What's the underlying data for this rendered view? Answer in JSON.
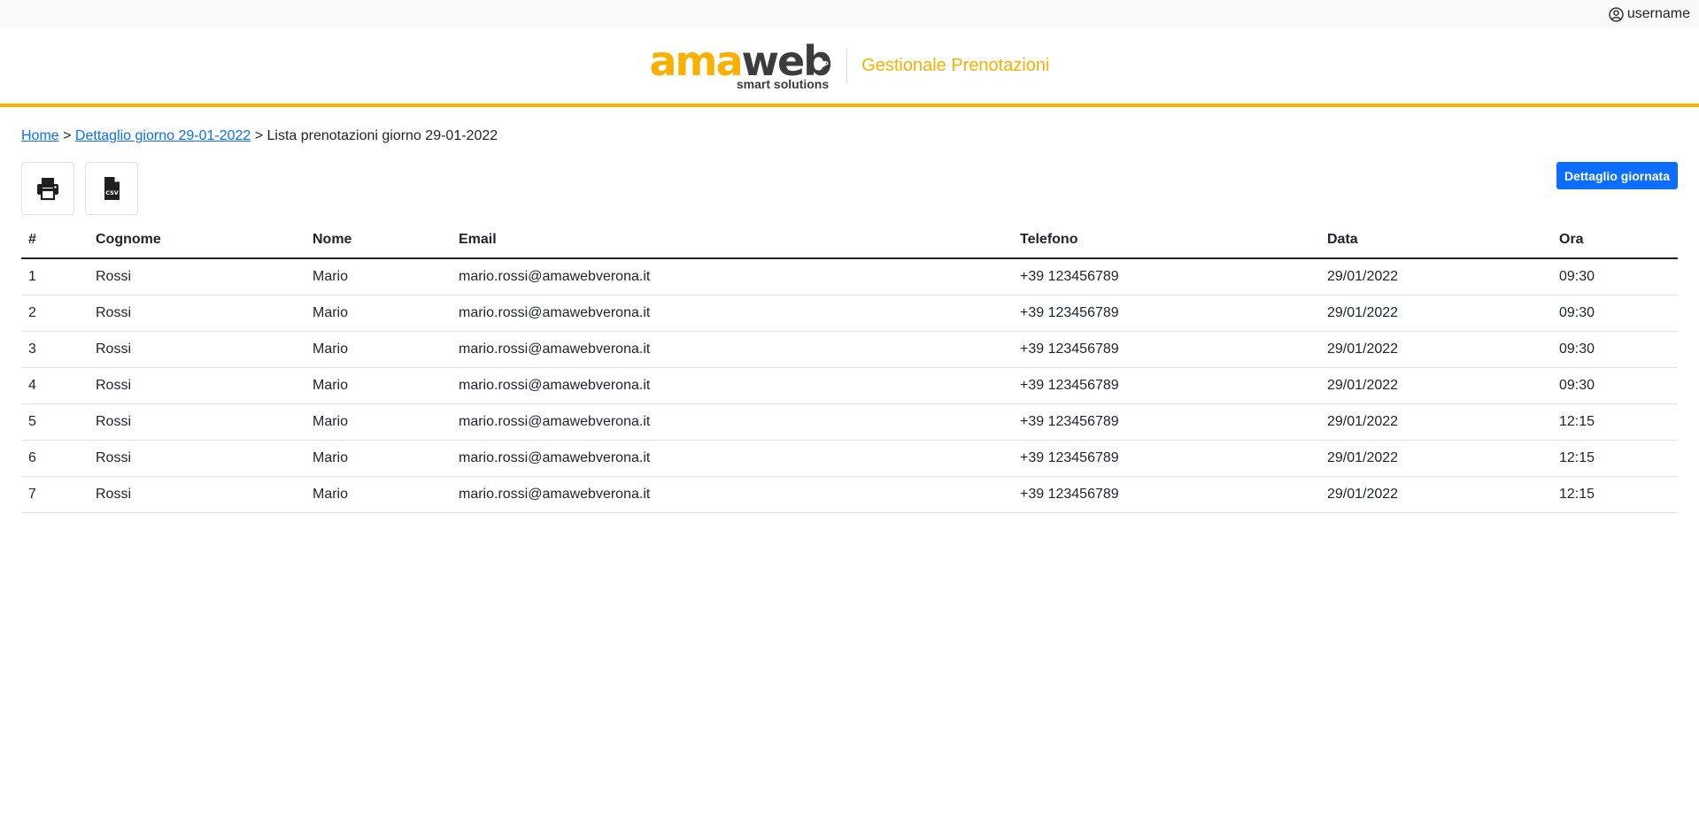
{
  "user": {
    "icon": "user-circle-icon",
    "name": "username"
  },
  "header": {
    "logo_ama": "ama",
    "logo_we": "we",
    "logo_b": "b",
    "logo_tagline": "smart solutions",
    "title": "Gestionale Prenotazioni",
    "accent_color": "#ffb000"
  },
  "breadcrumb": {
    "home": "Home",
    "sep1": " > ",
    "detail": "Dettaglio giorno 29-01-2022",
    "sep2": " > ",
    "current": "Lista prenotazioni giorno 29-01-2022"
  },
  "toolbar": {
    "print_icon": "printer-icon",
    "csv_icon": "csv-file-icon",
    "csv_label": "CSV",
    "detail_button": "Dettaglio giornata",
    "button_color": "#0d6efd"
  },
  "table": {
    "headers": [
      "#",
      "Cognome",
      "Nome",
      "Email",
      "Telefono",
      "Data",
      "Ora"
    ],
    "rows": [
      [
        "1",
        "Rossi",
        "Mario",
        "mario.rossi@amawebverona.it",
        "+39 123456789",
        "29/01/2022",
        "09:30"
      ],
      [
        "2",
        "Rossi",
        "Mario",
        "mario.rossi@amawebverona.it",
        "+39 123456789",
        "29/01/2022",
        "09:30"
      ],
      [
        "3",
        "Rossi",
        "Mario",
        "mario.rossi@amawebverona.it",
        "+39 123456789",
        "29/01/2022",
        "09:30"
      ],
      [
        "4",
        "Rossi",
        "Mario",
        "mario.rossi@amawebverona.it",
        "+39 123456789",
        "29/01/2022",
        "09:30"
      ],
      [
        "5",
        "Rossi",
        "Mario",
        "mario.rossi@amawebverona.it",
        "+39 123456789",
        "29/01/2022",
        "12:15"
      ],
      [
        "6",
        "Rossi",
        "Mario",
        "mario.rossi@amawebverona.it",
        "+39 123456789",
        "29/01/2022",
        "12:15"
      ],
      [
        "7",
        "Rossi",
        "Mario",
        "mario.rossi@amawebverona.it",
        "+39 123456789",
        "29/01/2022",
        "12:15"
      ]
    ]
  }
}
